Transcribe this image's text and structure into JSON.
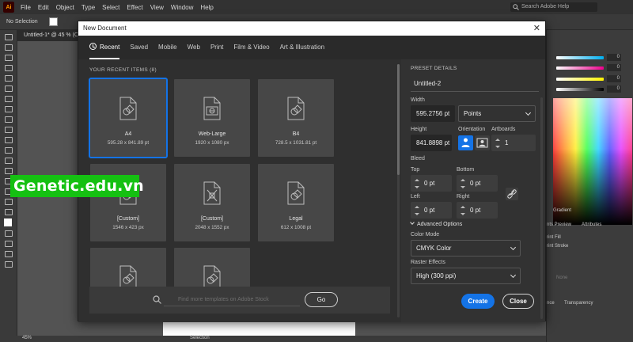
{
  "app": {
    "logo": "Ai",
    "menu": [
      "File",
      "Edit",
      "Object",
      "Type",
      "Select",
      "Effect",
      "View",
      "Window",
      "Help"
    ],
    "search_placeholder": "Search Adobe Help",
    "control_bar_label": "No Selection",
    "document_tab": "Untitled-1* @ 45 % (C",
    "zoom": "45%",
    "status_tool": "Selection"
  },
  "right_panel": {
    "percentages": [
      "0",
      "0",
      "0",
      "0"
    ],
    "tabs": {
      "gradient": "Gradient",
      "print_preview": "nts Preview",
      "attributes": "Attributes",
      "transparency": "Transparency",
      "nce": "nce"
    },
    "overprint_fill": "rint Fill",
    "overprint_stroke": "rint Stroke",
    "none_label": "None"
  },
  "watermark": "Genetic.edu.vn",
  "dialog": {
    "title": "New Document",
    "tabs": [
      "Recent",
      "Saved",
      "Mobile",
      "Web",
      "Print",
      "Film & Video",
      "Art & Illustration"
    ],
    "recent_heading": "YOUR RECENT ITEMS  (8)",
    "items": [
      {
        "name": "A4",
        "dims": "595.28 x 841.89 pt",
        "icon": "document-icon"
      },
      {
        "name": "Web-Large",
        "dims": "1920 x 1080 px",
        "icon": "web-document-icon"
      },
      {
        "name": "B4",
        "dims": "728.5 x 1031.81 pt",
        "icon": "document-icon"
      },
      {
        "name": "[Custom]",
        "dims": "1546 x 423 px",
        "icon": "document-icon"
      },
      {
        "name": "[Custom]",
        "dims": "2048 x 1552 px",
        "icon": "art-document-icon"
      },
      {
        "name": "Legal",
        "dims": "612 x 1008 pt",
        "icon": "document-icon"
      },
      {
        "name": "",
        "dims": "",
        "icon": "document-icon"
      },
      {
        "name": "",
        "dims": "",
        "icon": "art-document-icon"
      }
    ],
    "search_placeholder": "Find more templates on Adobe Stock",
    "go_label": "Go",
    "preset": {
      "heading": "PRESET DETAILS",
      "name": "Untitled-2",
      "width_label": "Width",
      "width": "595.2756 pt",
      "units": "Points",
      "height_label": "Height",
      "height": "841.8898 pt",
      "orientation_label": "Orientation",
      "artboards_label": "Artboards",
      "artboards": "1",
      "bleed_label": "Bleed",
      "top_label": "Top",
      "top": "0 pt",
      "bottom_label": "Bottom",
      "bottom": "0 pt",
      "left_label": "Left",
      "left": "0 pt",
      "right_label": "Right",
      "right": "0 pt",
      "advanced": "Advanced Options",
      "color_mode_label": "Color Mode",
      "color_mode": "CMYK Color",
      "raster_label": "Raster Effects",
      "raster": "High (300 ppi)"
    },
    "create_label": "Create",
    "close_label": "Close"
  },
  "colors": {
    "accent": "#1473e6",
    "dialog_bg": "#323232",
    "watermark_bg": "#15c012"
  }
}
